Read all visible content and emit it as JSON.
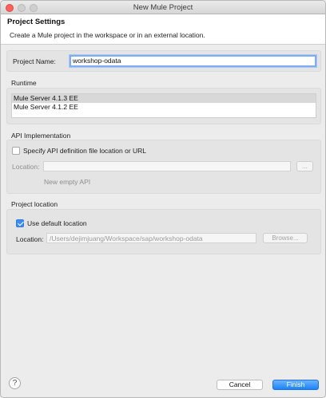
{
  "window": {
    "title": "New Mule Project"
  },
  "header": {
    "title": "Project Settings",
    "description": "Create a Mule project in the workspace or in an external location."
  },
  "project_name": {
    "label": "Project Name:",
    "value": "workshop-odata"
  },
  "runtime": {
    "title": "Runtime",
    "items": [
      {
        "label": "Mule Server 4.1.3 EE",
        "selected": true
      },
      {
        "label": "Mule Server 4.1.2 EE",
        "selected": false
      }
    ]
  },
  "api": {
    "title": "API Implementation",
    "specify_checkbox_label": "Specify API definition file location or URL",
    "specify_checked": false,
    "location_label": "Location:",
    "location_value": "",
    "browse_label": "...",
    "new_empty_api_label": "New empty API"
  },
  "project_location": {
    "title": "Project location",
    "use_default_label": "Use default location",
    "use_default_checked": true,
    "location_label": "Location:",
    "location_value": "/Users/dejimjuang/Workspace/sap/workshop-odata",
    "browse_label": "Browse..."
  },
  "footer": {
    "help_label": "?",
    "cancel_label": "Cancel",
    "finish_label": "Finish"
  },
  "colors": {
    "accent": "#1a82fb",
    "close_button": "#fc605b",
    "background": "#ececec"
  }
}
